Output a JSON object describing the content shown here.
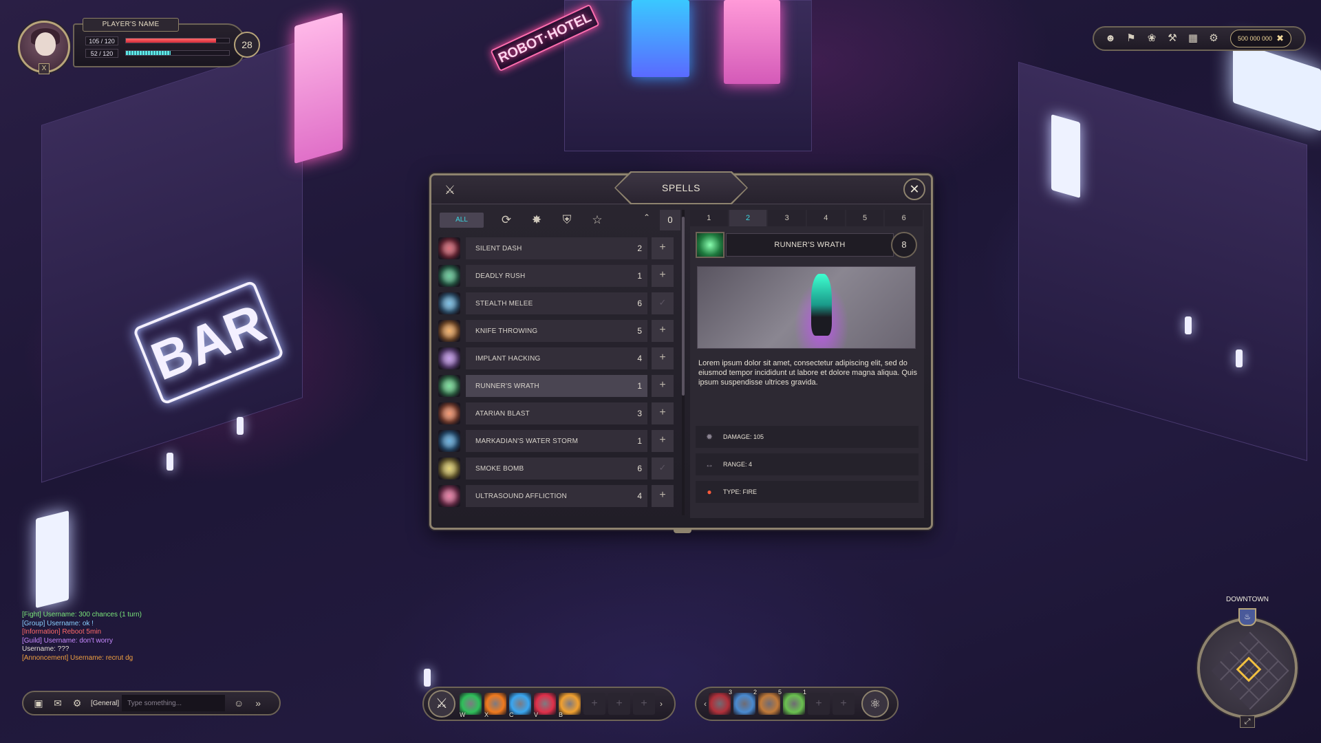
{
  "player": {
    "name": "PLAYER'S NAME",
    "hp_text": "105 / 120",
    "hp_fraction": 0.875,
    "mp_text": "52 / 120",
    "mp_fraction": 0.433,
    "level": "28",
    "badge_icon": "x-emblem-icon"
  },
  "top_menu": {
    "icons": [
      "profile-icon",
      "flag-icon",
      "paw-icon",
      "tools-icon",
      "stats-icon",
      "settings-icon"
    ],
    "gold": "500 000 000"
  },
  "spells_window": {
    "title": "SPELLS",
    "filter_all": "ALL",
    "filter_icons": [
      "cycle-icon",
      "badge-icon",
      "shield-icon",
      "star-icon"
    ],
    "points": "0",
    "spells": [
      {
        "name": "SILENT DASH",
        "level": "2",
        "color": "#c8263a",
        "learned": false
      },
      {
        "name": "DEADLY RUSH",
        "level": "1",
        "color": "#22b36a",
        "learned": false
      },
      {
        "name": "STEALTH MELEE",
        "level": "6",
        "color": "#3aa0d8",
        "learned": true
      },
      {
        "name": "KNIFE THROWING",
        "level": "5",
        "color": "#f08a1e",
        "learned": false
      },
      {
        "name": "IMPLANT HACKING",
        "level": "4",
        "color": "#a86ae0",
        "learned": false
      },
      {
        "name": "RUNNER'S WRATH",
        "level": "1",
        "color": "#3bd26a",
        "learned": false
      },
      {
        "name": "ATARIAN BLAST",
        "level": "3",
        "color": "#f0642a",
        "learned": false
      },
      {
        "name": "MARKADIAN'S WATER STORM",
        "level": "1",
        "color": "#1f8ad0",
        "learned": false
      },
      {
        "name": "SMOKE BOMB",
        "level": "6",
        "color": "#d8c030",
        "learned": true
      },
      {
        "name": "ULTRASOUND AFFLICTION",
        "level": "4",
        "color": "#e0407a",
        "learned": false
      }
    ],
    "selected_index": 5,
    "rank_tabs": [
      "1",
      "2",
      "3",
      "4",
      "5",
      "6"
    ],
    "active_rank": 1,
    "detail": {
      "name": "RUNNER'S WRATH",
      "level": "8",
      "description": "Lorem ipsum dolor sit amet, consectetur adipiscing elit, sed do eiusmod tempor incididunt ut labore et dolore magna aliqua. Quis ipsum suspendisse ultrices gravida.",
      "damage": "DAMAGE: 105",
      "range": "RANGE: 4",
      "type": "TYPE: FIRE"
    }
  },
  "chat": {
    "lines": [
      {
        "cls": "c-fight",
        "text": "[Fight] Username: 300 chances (1 turn)"
      },
      {
        "cls": "c-group",
        "text": "[Group] Username: ok !"
      },
      {
        "cls": "c-info",
        "text": "[Information] Reboot 5min"
      },
      {
        "cls": "c-guild",
        "text": "[Guild] Username: don't worry"
      },
      {
        "cls": "c-plain",
        "text": "Username: ???"
      },
      {
        "cls": "c-ann",
        "text": "[Annoncement] Username: recrut dg"
      }
    ],
    "channel": "[General]",
    "placeholder": "Type something..."
  },
  "action_bar": {
    "spell_slots": [
      {
        "key": "W",
        "color": "#2fbf5a"
      },
      {
        "key": "X",
        "color": "#f07a1e"
      },
      {
        "key": "C",
        "color": "#3aa6f0"
      },
      {
        "key": "V",
        "color": "#e0304a"
      },
      {
        "key": "B",
        "color": "#f0a030"
      }
    ],
    "empty_slots": 3
  },
  "item_bar": {
    "items": [
      {
        "qty": "3",
        "color": "#b0303a"
      },
      {
        "qty": "2",
        "color": "#4a8ad0"
      },
      {
        "qty": "5",
        "color": "#c07a3a"
      },
      {
        "qty": "1",
        "color": "#6ac050"
      }
    ],
    "empty_slots": 2
  },
  "minimap": {
    "label": "DOWNTOWN"
  }
}
